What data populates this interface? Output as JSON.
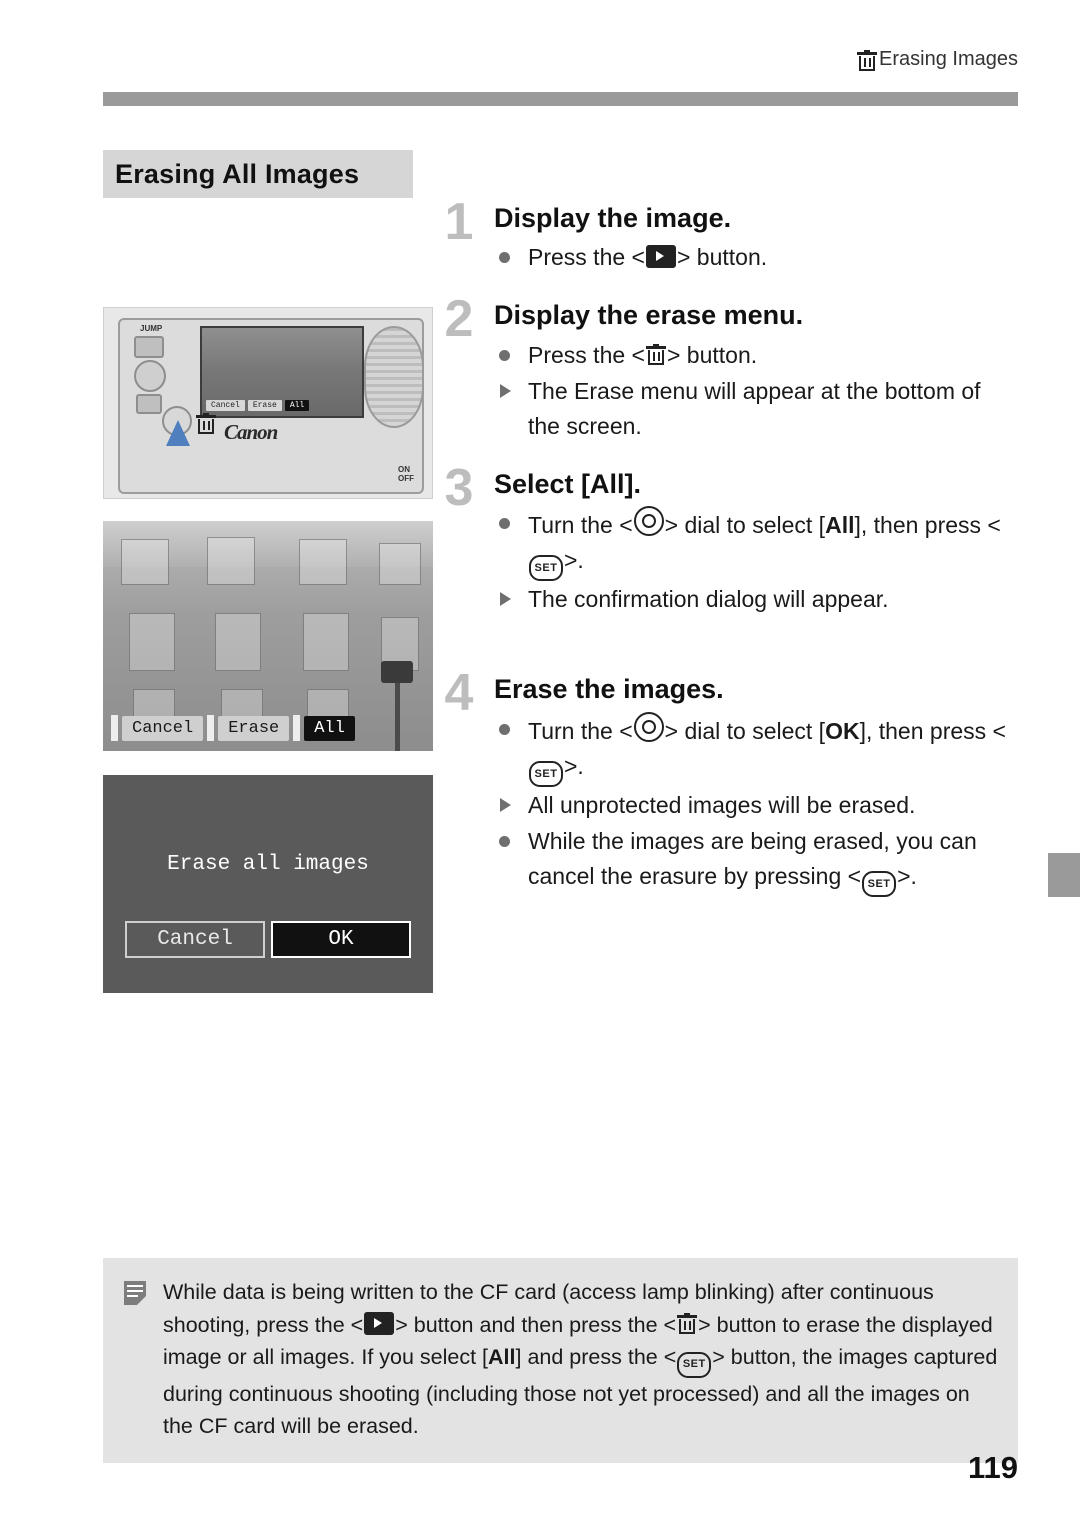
{
  "header": {
    "icon": "trash-icon",
    "title": "Erasing Images"
  },
  "section": {
    "title": "Erasing All Images"
  },
  "steps": [
    {
      "number": "1",
      "heading": "Display the image.",
      "lines": [
        {
          "type": "bullet",
          "pre": "Press the <",
          "glyph": "playback-icon",
          "post": "> button."
        }
      ]
    },
    {
      "number": "2",
      "heading": "Display the erase menu.",
      "lines": [
        {
          "type": "bullet",
          "pre": "Press the <",
          "glyph": "trash-icon",
          "post": "> button."
        },
        {
          "type": "arrow",
          "text": "The Erase menu will appear at the bottom of the screen."
        }
      ]
    },
    {
      "number": "3",
      "heading": "Select [All].",
      "lines": [
        {
          "type": "bullet",
          "pre": "Turn the <",
          "glyph": "dial-icon",
          "mid": "> dial to select [",
          "strong": "All",
          "post": "], then press <",
          "glyph2": "set-icon",
          "end": ">."
        },
        {
          "type": "arrow",
          "text": "The confirmation dialog will appear."
        }
      ]
    },
    {
      "number": "4",
      "heading": "Erase the images.",
      "lines": [
        {
          "type": "bullet",
          "pre": "Turn the <",
          "glyph": "dial-icon",
          "mid": "> dial to select [",
          "strong": "OK",
          "post": "], then press <",
          "glyph2": "set-icon",
          "end": ">."
        },
        {
          "type": "arrow",
          "text": "All unprotected images will be erased."
        },
        {
          "type": "bullet",
          "pre": "While the images are being erased, you can cancel the erasure by pressing <",
          "glyph": "set-icon",
          "post": ">."
        }
      ]
    }
  ],
  "figures": {
    "camera": {
      "name": "camera-rear-illustration",
      "brand": "Canon",
      "jump_label": "JUMP",
      "power_on": "ON",
      "power_off": "OFF",
      "screen_menu": [
        "Cancel",
        "Erase",
        "All"
      ],
      "screen_menu_selected": "All"
    },
    "photo": {
      "name": "lcd-playback-illustration",
      "menu": [
        "Cancel",
        "Erase",
        "All"
      ],
      "menu_selected": "All"
    },
    "dialog": {
      "name": "erase-confirmation-dialog",
      "message": "Erase all images",
      "buttons": [
        "Cancel",
        "OK"
      ],
      "selected": "OK"
    }
  },
  "note": {
    "icon": "note-icon",
    "text": "While data is being written to the CF card (access lamp blinking) after continuous shooting, press the <▶> button and then press the <trash> button to erase the displayed image or all images. If you select [All] and press the <SET> button, the images captured during continuous shooting (including those not yet processed) and all the images on the CF card will be erased.",
    "segments": [
      "While data is being written to the CF card (access lamp blinking) after continuous shooting, press the <",
      "> button and then press the <",
      "> button to erase the displayed image or all images. If you select [",
      "All",
      "] and press the <",
      "> button, the images captured during continuous shooting (including those not yet processed) and all the images on the CF card will be erased."
    ]
  },
  "page_number": "119"
}
